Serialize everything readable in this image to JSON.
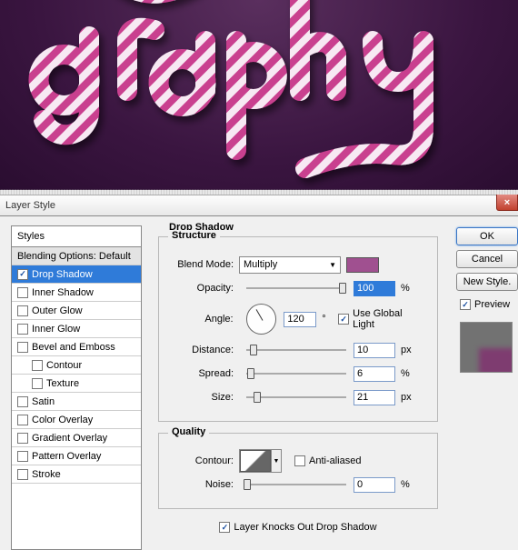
{
  "canvas": {
    "text_fragment": "graphy"
  },
  "dialog": {
    "title": "Layer Style",
    "close": "×"
  },
  "styles_panel": {
    "header": "Styles",
    "default_row": "Blending Options: Default",
    "items": [
      {
        "label": "Drop Shadow",
        "checked": true,
        "selected": true,
        "indent": false
      },
      {
        "label": "Inner Shadow",
        "checked": false,
        "selected": false,
        "indent": false
      },
      {
        "label": "Outer Glow",
        "checked": false,
        "selected": false,
        "indent": false
      },
      {
        "label": "Inner Glow",
        "checked": false,
        "selected": false,
        "indent": false
      },
      {
        "label": "Bevel and Emboss",
        "checked": false,
        "selected": false,
        "indent": false
      },
      {
        "label": "Contour",
        "checked": false,
        "selected": false,
        "indent": true
      },
      {
        "label": "Texture",
        "checked": false,
        "selected": false,
        "indent": true
      },
      {
        "label": "Satin",
        "checked": false,
        "selected": false,
        "indent": false
      },
      {
        "label": "Color Overlay",
        "checked": false,
        "selected": false,
        "indent": false
      },
      {
        "label": "Gradient Overlay",
        "checked": false,
        "selected": false,
        "indent": false
      },
      {
        "label": "Pattern Overlay",
        "checked": false,
        "selected": false,
        "indent": false
      },
      {
        "label": "Stroke",
        "checked": false,
        "selected": false,
        "indent": false
      }
    ]
  },
  "settings": {
    "section_title": "Drop Shadow",
    "structure": {
      "label": "Structure",
      "blend_mode_label": "Blend Mode:",
      "blend_mode_value": "Multiply",
      "color": "#a05090",
      "opacity_label": "Opacity:",
      "opacity_value": "100",
      "opacity_unit": "%",
      "angle_label": "Angle:",
      "angle_value": "120",
      "angle_unit": "°",
      "use_global_label": "Use Global Light",
      "use_global_checked": true,
      "distance_label": "Distance:",
      "distance_value": "10",
      "distance_unit": "px",
      "spread_label": "Spread:",
      "spread_value": "6",
      "spread_unit": "%",
      "size_label": "Size:",
      "size_value": "21",
      "size_unit": "px"
    },
    "quality": {
      "label": "Quality",
      "contour_label": "Contour:",
      "anti_aliased_label": "Anti-aliased",
      "anti_aliased_checked": false,
      "noise_label": "Noise:",
      "noise_value": "0",
      "noise_unit": "%"
    },
    "knockout_label": "Layer Knocks Out Drop Shadow",
    "knockout_checked": true
  },
  "right": {
    "ok": "OK",
    "cancel": "Cancel",
    "new_style": "New Style.",
    "preview_label": "Preview",
    "preview_checked": true
  }
}
